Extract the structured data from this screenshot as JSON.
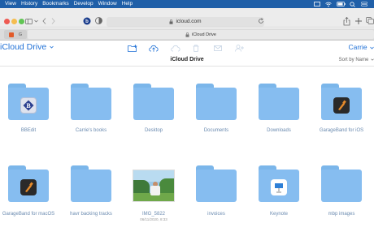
{
  "menubar": {
    "items": [
      "View",
      "History",
      "Bookmarks",
      "Develop",
      "Window",
      "Help"
    ]
  },
  "browser": {
    "url": "icloud.com",
    "tab_title": "iCloud Drive",
    "tab_favicon_letter": "G"
  },
  "header": {
    "app_title": "iCloud Drive",
    "user": "Carrie"
  },
  "folder": {
    "title": "iCloud Drive",
    "sort_label": "Sort by Name"
  },
  "items": [
    {
      "label": "BBEdit",
      "sub": "",
      "kind": "folder",
      "badge": "bbedit-icon"
    },
    {
      "label": "Carrie's books",
      "sub": "",
      "kind": "folder",
      "badge": ""
    },
    {
      "label": "Desktop",
      "sub": "",
      "kind": "folder",
      "badge": ""
    },
    {
      "label": "Documents",
      "sub": "",
      "kind": "folder",
      "badge": ""
    },
    {
      "label": "Downloads",
      "sub": "",
      "kind": "folder",
      "badge": ""
    },
    {
      "label": "GarageBand for iOS",
      "sub": "",
      "kind": "folder",
      "badge": "garageband-icon"
    },
    {
      "label": "GarageBand for macOS",
      "sub": "",
      "kind": "folder",
      "badge": "garageband-icon"
    },
    {
      "label": "havr backing tracks",
      "sub": "",
      "kind": "folder",
      "badge": ""
    },
    {
      "label": "IMG_5822",
      "sub": "06/11/2020, 8:33",
      "kind": "photo",
      "badge": ""
    },
    {
      "label": "invoices",
      "sub": "",
      "kind": "folder",
      "badge": ""
    },
    {
      "label": "Keynote",
      "sub": "",
      "kind": "folder",
      "badge": "keynote-icon"
    },
    {
      "label": "mbp images",
      "sub": "",
      "kind": "folder",
      "badge": ""
    }
  ],
  "colors": {
    "menubar_bg": "#1f5fa8",
    "accent": "#1f70d6",
    "folder": "#86bdf0",
    "folder_tab": "#7bb6ea",
    "label": "#6b8bb0"
  }
}
